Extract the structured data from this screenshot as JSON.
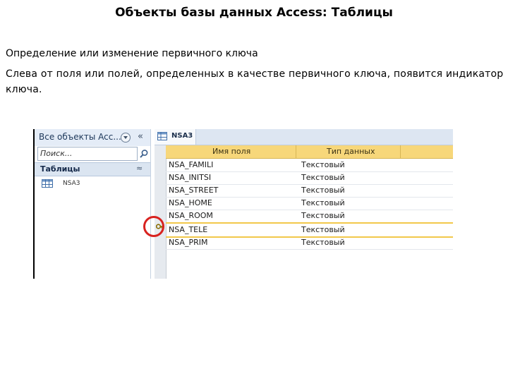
{
  "slide": {
    "title": "Объекты базы данных Access: Таблицы",
    "subtitle": "Определение или изменение первичного ключа",
    "body": "Слева от поля или полей, определенных в качестве первичного ключа, появится индикатор ключа."
  },
  "access": {
    "nav": {
      "header_title": "Все объекты Acc...",
      "search_placeholder": "Поиск...",
      "group_label": "Таблицы",
      "group_chevron": "≈",
      "items": [
        {
          "label": "NSA3"
        }
      ]
    },
    "tab": {
      "label": "NSA3"
    },
    "grid": {
      "columns": [
        "Имя поля",
        "Тип данных"
      ],
      "rows": [
        {
          "name": "NSA_FAMILI",
          "type": "Текстовый"
        },
        {
          "name": "NSA_INITSI",
          "type": "Текстовый"
        },
        {
          "name": "NSA_STREET",
          "type": "Текстовый"
        },
        {
          "name": "NSA_HOME",
          "type": "Текстовый"
        },
        {
          "name": "NSA_ROOM",
          "type": "Текстовый"
        },
        {
          "name": "NSA_TELE",
          "type": "Текстовый",
          "primary_key": true
        },
        {
          "name": "NSA_PRIM",
          "type": "Текстовый"
        }
      ]
    },
    "colors": {
      "header_bg": "#f7d77a",
      "selected_row_border": "#f2c84b",
      "highlight_circle": "#d8221f"
    }
  }
}
